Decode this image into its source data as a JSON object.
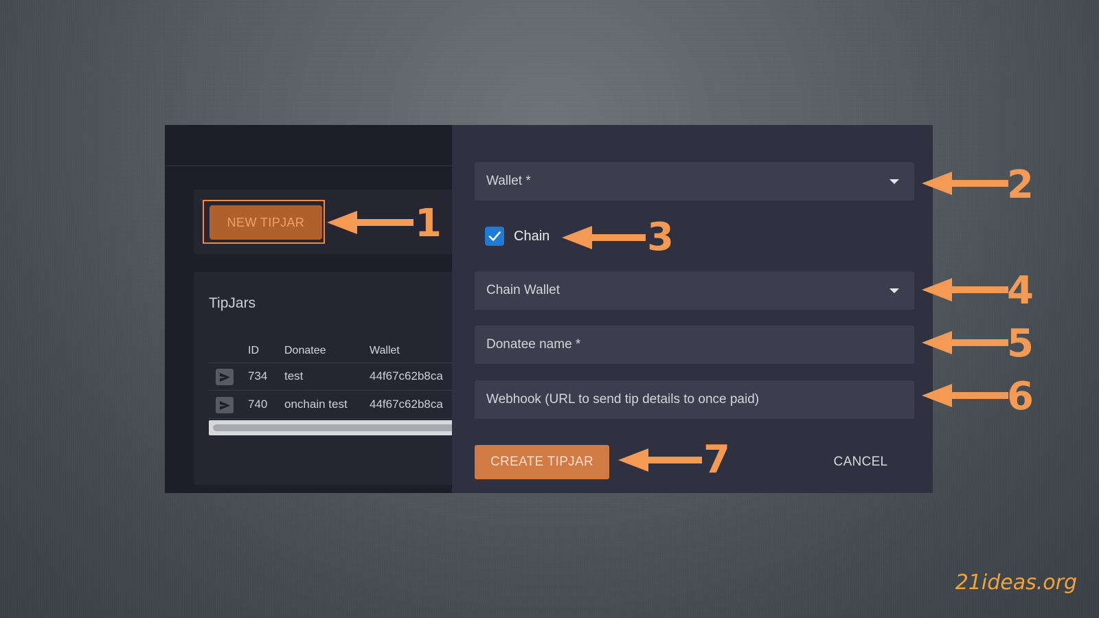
{
  "left_panel": {
    "new_button_label": "NEW TIPJAR",
    "list_title": "TipJars",
    "columns": [
      "ID",
      "Donatee",
      "Wallet"
    ],
    "rows": [
      {
        "id": "734",
        "donatee": "test",
        "wallet": "44f67c62b8ca"
      },
      {
        "id": "740",
        "donatee": "onchain test",
        "wallet": "44f67c62b8ca"
      }
    ]
  },
  "dialog": {
    "wallet_label": "Wallet *",
    "chain_checkbox_label": "Chain",
    "chain_checked": true,
    "chain_wallet_label": "Chain Wallet",
    "donatee_label": "Donatee name *",
    "webhook_label": "Webhook (URL to send tip details to once paid)",
    "create_label": "CREATE TIPJAR",
    "cancel_label": "CANCEL"
  },
  "annotations": [
    "1",
    "2",
    "3",
    "4",
    "5",
    "6",
    "7"
  ],
  "watermark": "21ideas.org",
  "colors": {
    "accent_orange": "#f59a55",
    "create_button": "#d27a43",
    "new_button": "#b0602b",
    "checkbox_blue": "#1f7bd8",
    "watermark": "#f2a33c"
  },
  "icons": {
    "send": "send-icon",
    "dropdown": "chevron-down-icon",
    "check": "check-icon"
  }
}
